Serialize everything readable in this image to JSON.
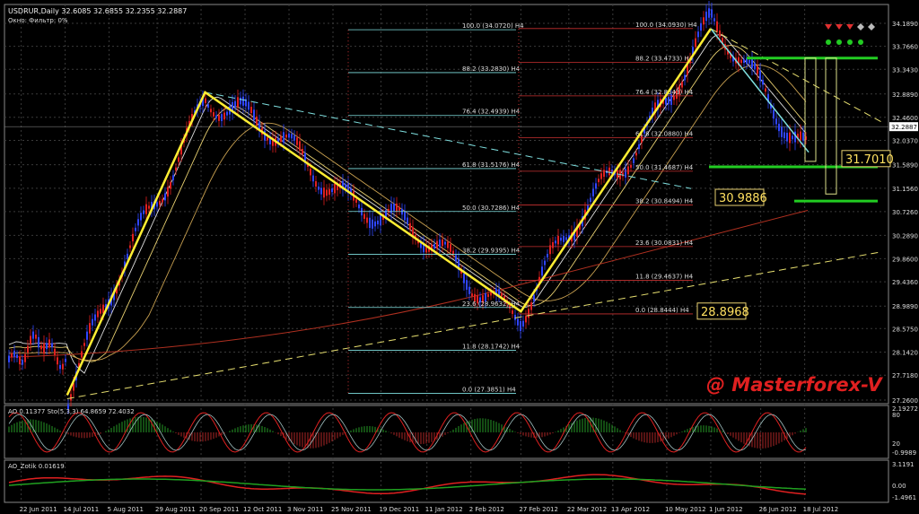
{
  "header": {
    "symbol_line": "USDRUR,Daily  32.6085 32.6855 32.2355 32.2887",
    "indicator_line": "Окно: Фильтр: 0%"
  },
  "watermark": "@ Masterforex-V",
  "colors": {
    "background": "#000000",
    "grid": "#3a3a3a",
    "candle_up": "#2f45ff",
    "candle_down": "#e02020",
    "zigzag": "#ffee33",
    "fib": "#7fe0e0",
    "fib_red": "#c83030",
    "green_level": "#22cc22",
    "watermark": "#e02020"
  },
  "chart_data": [
    {
      "type": "line",
      "title": "",
      "ylim": [
        27.26,
        34.189
      ],
      "yticks": [
        "34.1890",
        "33.7660",
        "33.3430",
        "32.8890",
        "32.4600",
        "32.0370",
        "31.5890",
        "31.1560",
        "30.7260",
        "30.2890",
        "29.8600",
        "29.4360",
        "28.9890",
        "28.5750",
        "28.1420",
        "27.7180",
        "27.2600"
      ],
      "xticks": [
        "22 Jun 2011",
        "14 Jul 2011",
        "5 Aug 2011",
        "29 Aug 2011",
        "20 Sep 2011",
        "12 Oct 2011",
        "3 Nov 2011",
        "25 Nov 2011",
        "19 Dec 2011",
        "11 Jan 2012",
        "2 Feb 2012",
        "27 Feb 2012",
        "22 Mar 2012",
        "13 Apr 2012",
        "10 May 2012",
        "1 Jun 2012",
        "26 Jun 2012",
        "18 Jul 2012"
      ],
      "current_price": "32.2887",
      "zigzag_points": [
        {
          "date": "15 Jul 2011",
          "price": 27.35
        },
        {
          "date": "22 Sep 2011",
          "price": 32.92
        },
        {
          "date": "27 Feb 2012",
          "price": 28.89
        },
        {
          "date": "1 Jun 2012",
          "price": 34.09
        },
        {
          "date": "20 Jul 2012",
          "price": 31.95
        }
      ],
      "fib_left": [
        {
          "label": "100.0 (34.0720) H4",
          "price": 34.072
        },
        {
          "label": "88.2 (33.2830) H4",
          "price": 33.283
        },
        {
          "label": "76.4 (32.4939) H4",
          "price": 32.4939
        },
        {
          "label": "61.8 (31.5176) H4",
          "price": 31.5176
        },
        {
          "label": "50.0 (30.7286) H4",
          "price": 30.7286
        },
        {
          "label": "38.2 (29.9395) H4",
          "price": 29.9395
        },
        {
          "label": "23.6 (28.9632) H4",
          "price": 28.9632
        },
        {
          "label": "11.8 (28.1742) H4",
          "price": 28.1742
        },
        {
          "label": "0.0 (27.3851) H4",
          "price": 27.3851
        }
      ],
      "fib_right": [
        {
          "label": "100.0 (34.0930) H4",
          "price": 34.093
        },
        {
          "label": "88.2 (33.4733) H4",
          "price": 33.4733
        },
        {
          "label": "76.4 (32.8543) H4",
          "price": 32.8543
        },
        {
          "label": "61.8 (32.0880) H4",
          "price": 32.088
        },
        {
          "label": "50.0 (31.4687) H4",
          "price": 31.4687
        },
        {
          "label": "38.2 (30.8494) H4",
          "price": 30.8494
        },
        {
          "label": "23.6 (30.0831) H4",
          "price": 30.0831
        },
        {
          "label": "11.8 (29.4637) H4",
          "price": 29.4637
        },
        {
          "label": "0.0 (28.8444) H4",
          "price": 28.8444
        }
      ],
      "level_labels": [
        {
          "text": "31.7010",
          "price": 31.701
        },
        {
          "text": "30.9886",
          "price": 30.9886
        },
        {
          "text": "28.8968",
          "price": 28.8968
        }
      ],
      "green_levels": [
        33.55,
        31.55,
        30.92
      ]
    },
    {
      "type": "line",
      "title": "AO 0.11377  Sto(5,3,3) 64.8659 72.4032",
      "yticks": [
        "2.19272",
        "80",
        "20",
        "-0.9989"
      ]
    },
    {
      "type": "line",
      "title": "AO_Zotik 0.01619",
      "yticks": [
        "3.1191",
        "0.00",
        "-1.4961"
      ]
    }
  ]
}
